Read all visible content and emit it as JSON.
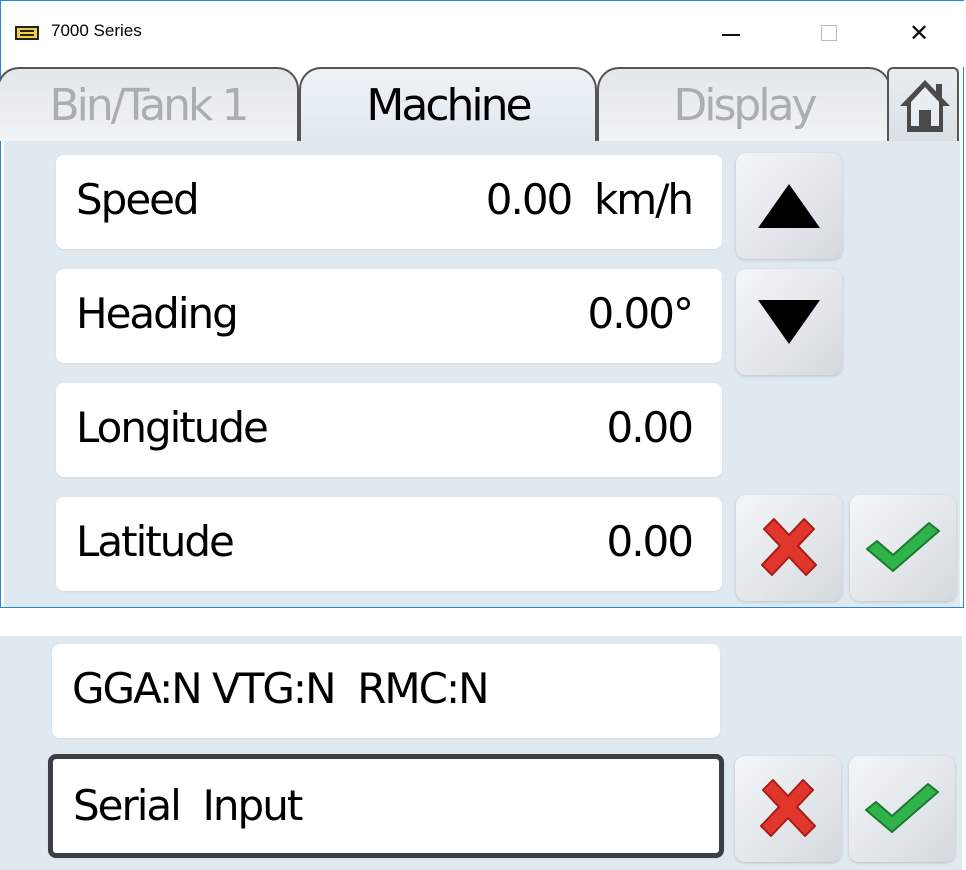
{
  "window": {
    "title": "7000 Series",
    "icon": "app-icon",
    "close_glyph": "✕"
  },
  "tabs": [
    {
      "label": "Bin/Tank 1",
      "active": false
    },
    {
      "label": "Machine",
      "active": true
    },
    {
      "label": "Display",
      "active": false
    }
  ],
  "home_icon": "house-icon",
  "fields": {
    "speed": {
      "label": "Speed",
      "value": "0.00",
      "unit": "km/h"
    },
    "heading": {
      "label": "Heading",
      "value": "0.00°"
    },
    "longitude": {
      "label": "Longitude",
      "value": "0.00"
    },
    "latitude": {
      "label": "Latitude",
      "value": "0.00"
    }
  },
  "lower": {
    "nmea_status": "GGA:N VTG:N  RMC:N",
    "source": "Serial  Input"
  },
  "buttons": {
    "up": "triangle-up-icon",
    "down": "triangle-down-icon",
    "cancel": "red-x-icon",
    "confirm": "green-check-icon"
  },
  "colors": {
    "accent_border": "#1e88e5",
    "panel_bg": "#e1e9f0",
    "cancel": "#d9342b",
    "confirm": "#2aa53a"
  }
}
